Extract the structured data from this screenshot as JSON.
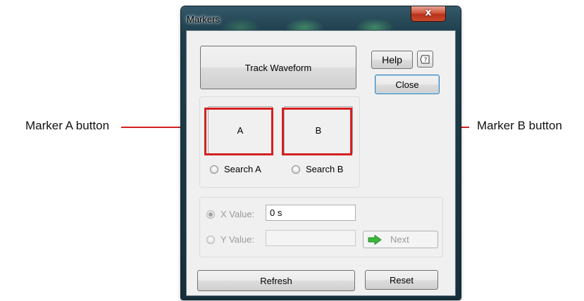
{
  "callouts": {
    "marker_a": "Marker A button",
    "marker_b": "Marker B button"
  },
  "window": {
    "title": "Markers",
    "close_glyph": "x"
  },
  "buttons": {
    "track_waveform": "Track Waveform",
    "help": "Help",
    "close": "Close",
    "marker_a": "A",
    "marker_b": "B",
    "next": "Next",
    "refresh": "Refresh",
    "reset": "Reset"
  },
  "search": {
    "a_label": "Search A",
    "b_label": "Search B"
  },
  "values": {
    "x_label": "X Value:",
    "x_value": "0 s",
    "y_label": "Y Value:",
    "y_value": ""
  },
  "colors": {
    "callout_highlight": "#d42020",
    "next_arrow": "#3cb63c"
  },
  "icons": {
    "help": "context-help-icon",
    "next": "green-right-arrow-icon"
  }
}
